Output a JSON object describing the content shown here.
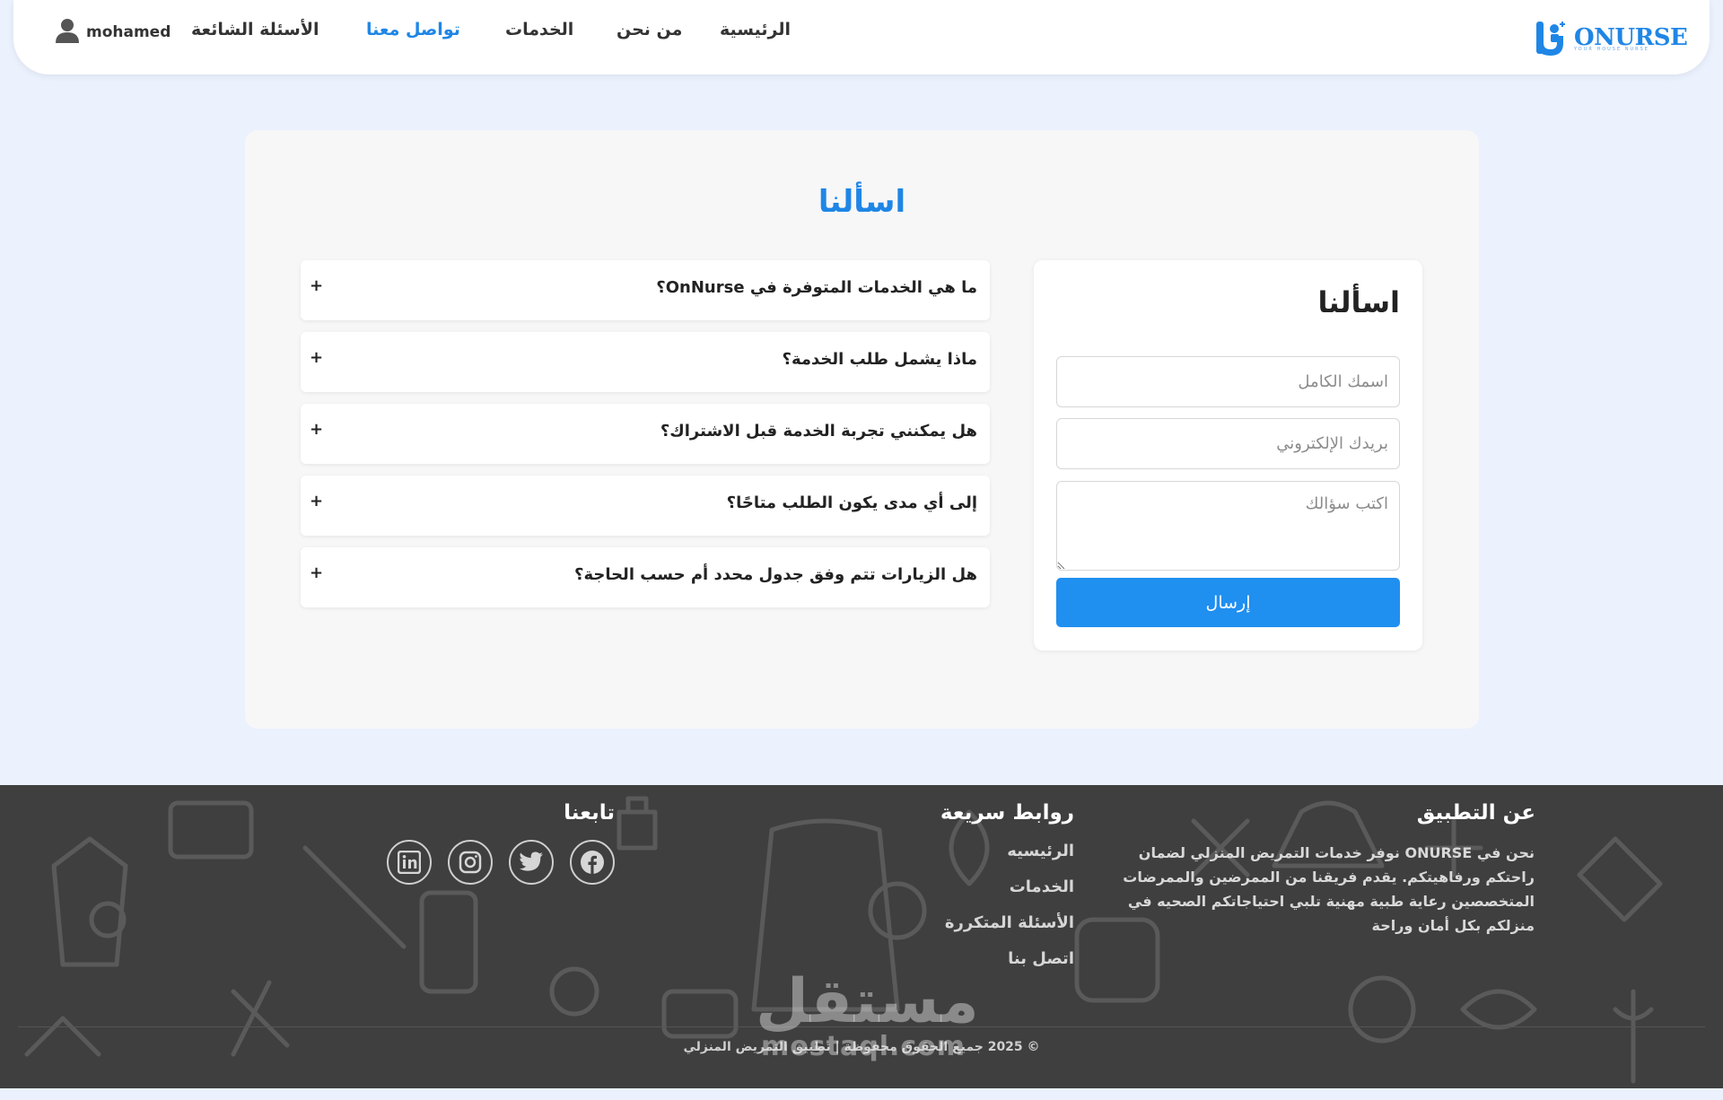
{
  "brand": {
    "name": "ONURSE",
    "tagline": "YOUR HOUSE NURSE"
  },
  "nav": {
    "home": "الرئيسية",
    "about": "من نحن",
    "services": "الخدمات",
    "contact": "تواصل معنا",
    "faq": "الأسئلة الشائعة",
    "active": "contact"
  },
  "user": {
    "name": "mohamed"
  },
  "main": {
    "title": "اسألنا",
    "faqs": [
      {
        "question": "ما هي الخدمات المتوفرة في OnNurse؟",
        "toggle": "+"
      },
      {
        "question": "ماذا يشمل طلب الخدمة؟",
        "toggle": "+"
      },
      {
        "question": "هل يمكنني تجربة الخدمة قبل الاشتراك؟",
        "toggle": "+"
      },
      {
        "question": "إلى أي مدى يكون الطلب متاحًا؟",
        "toggle": "+"
      },
      {
        "question": "هل الزيارات تتم وفق جدول محدد أم حسب الحاجة؟",
        "toggle": "+"
      }
    ],
    "form": {
      "title": "اسألنا",
      "name_placeholder": "اسمك الكامل",
      "email_placeholder": "بريدك الإلكتروني",
      "question_placeholder": "اكتب سؤالك",
      "submit_label": "إرسال"
    }
  },
  "footer": {
    "about_title": "عن التطبيق",
    "about_text": "نحن في ONURSE نوفر خدمات التمريض المنزلي لضمان راحتكم ورفاهيتكم. يقدم فريقنا من الممرضين والممرضات المتخصصين رعاية طبية مهنية تلبي احتياجاتكم الصحيه في منزلكم بكل أمان وراحة",
    "links_title": "روابط سريعة",
    "links": [
      "الرئيسيه",
      "الخدمات",
      "الأسئلة المتكررة",
      "اتصل بنا"
    ],
    "follow_title": "تابعنا",
    "social": [
      "facebook-icon",
      "twitter-icon",
      "instagram-icon",
      "linkedin-icon"
    ],
    "copyright": "© 2025 جميع الحقوق محفوظة | تطبيق التمريض المنزلي"
  },
  "watermark": {
    "arabic": "مستقل",
    "latin": "mostaql.com"
  },
  "colors": {
    "accent": "#1f86e6",
    "page_bg": "#ebf1fd",
    "footer_bg": "#3f3f3f",
    "button": "#1f8ff0"
  }
}
